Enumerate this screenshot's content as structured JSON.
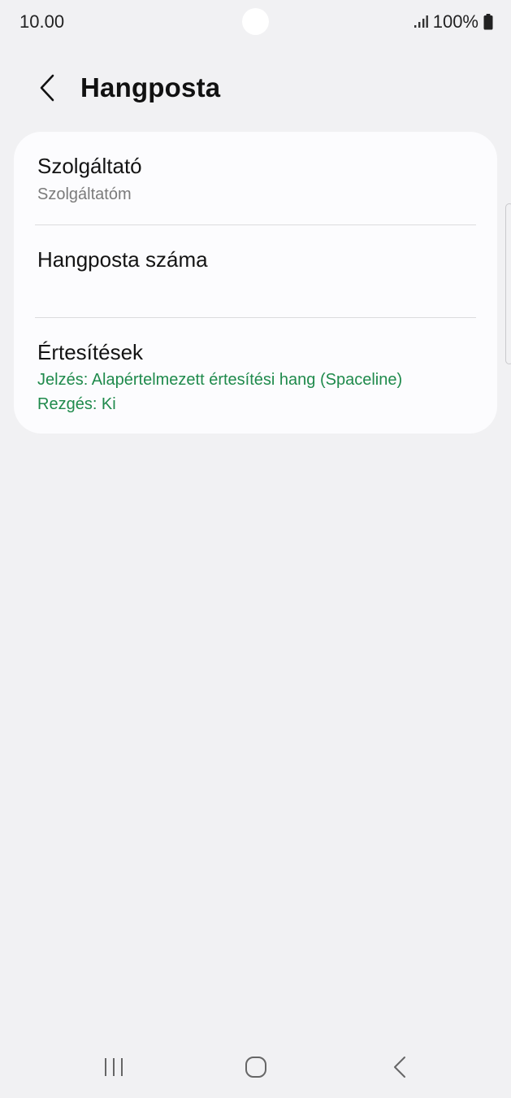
{
  "status_bar": {
    "time": "10.00",
    "battery": "100%"
  },
  "header": {
    "title": "Hangposta"
  },
  "settings": [
    {
      "title": "Szolgáltató",
      "subtitle": "Szolgáltatóm"
    },
    {
      "title": "Hangposta száma"
    },
    {
      "title": "Értesítések",
      "detail_lines": [
        "Jelzés: Alapértelmezett értesítési hang (Spaceline)",
        "Rezgés: Ki"
      ]
    }
  ],
  "colors": {
    "background": "#f1f1f3",
    "card": "#fcfcfe",
    "accent": "#1f8a4c",
    "secondary_text": "#7b7b7b"
  },
  "icons": {
    "status": [
      "signal-icon",
      "battery-icon"
    ],
    "header": [
      "back-arrow-icon"
    ],
    "navigation": [
      "recent-apps-icon",
      "home-icon",
      "back-icon"
    ]
  }
}
